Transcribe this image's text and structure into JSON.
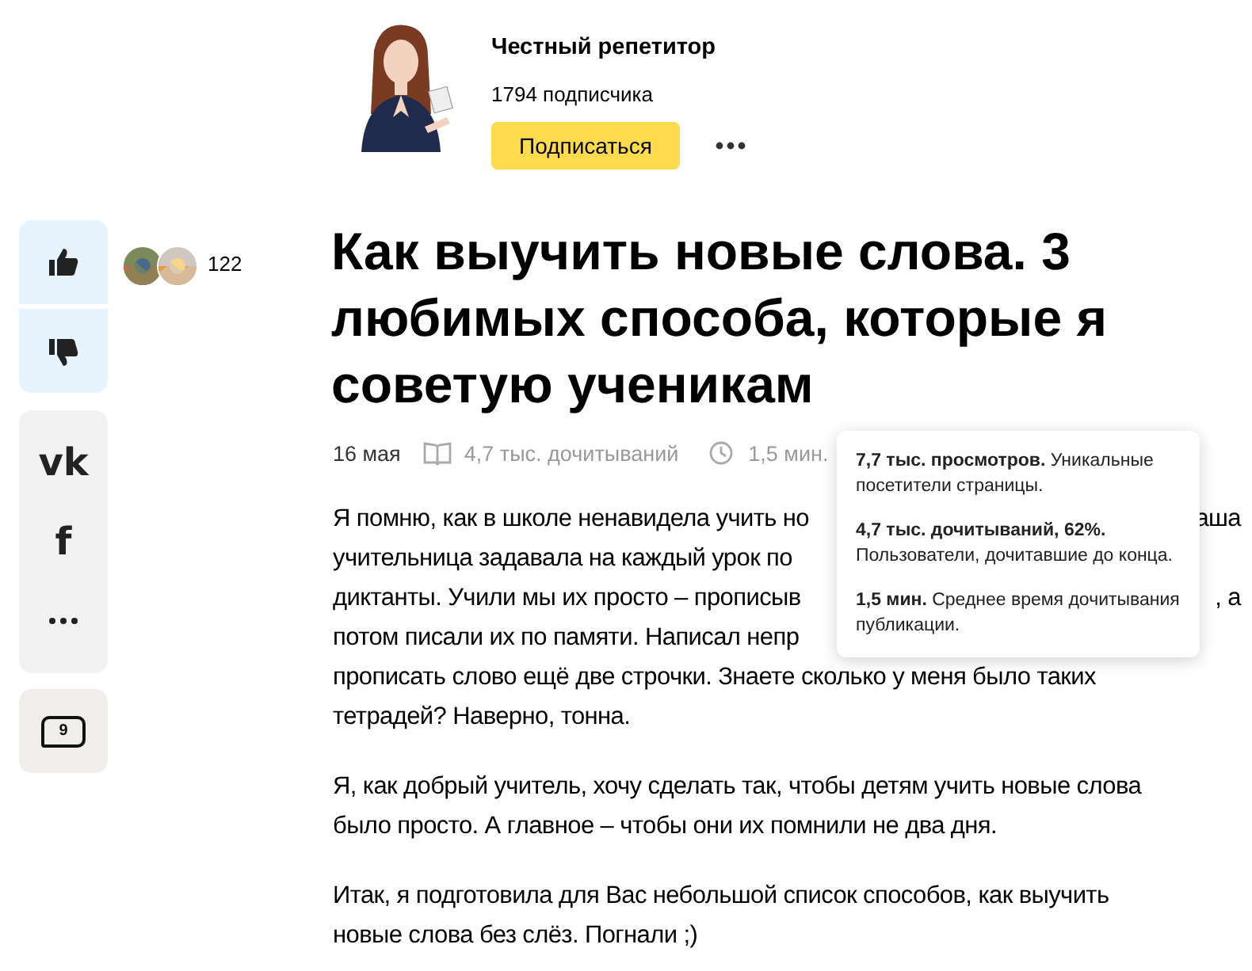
{
  "channel": {
    "name": "Честный репетитор",
    "subscribers": "1794 подписчика",
    "subscribe_button": "Подписаться"
  },
  "reactions": {
    "likes_count": "122"
  },
  "sidebar": {
    "share": [
      {
        "kind": "logo",
        "label": "vk"
      },
      {
        "kind": "logo",
        "label": "f"
      },
      {
        "kind": "more"
      }
    ],
    "comments_count": "9"
  },
  "article": {
    "title": "Как выучить новые слова. 3 любимых способа, которые я советую ученикам",
    "date": "16 мая",
    "reads": "4,7 тыс. дочитываний",
    "read_time": "1,5 мин.",
    "paragraphs": [
      {
        "kind": "lines",
        "lines": [
          {
            "left": "Я помню, как в школе ненавидела учить но",
            "right": "аша"
          },
          {
            "left": "учительница задавала на каждый урок по"
          },
          {
            "left": "диктанты. Учили мы их просто – прописыв",
            "right": ", а"
          },
          {
            "left": "потом писали их по памяти. Написал непр"
          },
          {
            "left": "прописать слово ещё две строчки. Знаете сколько у меня было таких"
          },
          {
            "left": "тетрадей? Наверно, тонна."
          }
        ]
      },
      {
        "kind": "lines",
        "lines": [
          {
            "left": "Я, как добрый учитель, хочу сделать так, чтобы детям учить новые слова"
          },
          {
            "left": "было просто. А главное – чтобы они их помнили не два дня."
          }
        ]
      },
      {
        "kind": "lines",
        "lines": [
          {
            "left": "Итак, я подготовила для Вас небольшой список способов, как выучить"
          },
          {
            "left": "новые слова без слёз. Погнали ;)"
          }
        ]
      }
    ]
  },
  "tooltip": {
    "items": [
      "**7,7 тыс. просмотров.** Уникальные посетители страницы.",
      "**4,7 тыс. дочитываний, 62%.** Пользователи, дочитавшие до конца.",
      "**1,5 мин.** Среднее время дочитывания публикации."
    ]
  }
}
